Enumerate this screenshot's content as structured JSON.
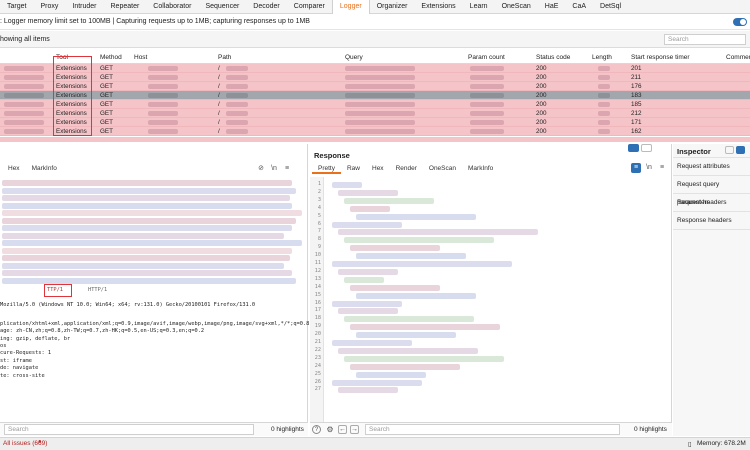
{
  "top_tabs": [
    "Target",
    "Proxy",
    "Intruder",
    "Repeater",
    "Collaborator",
    "Sequencer",
    "Decoder",
    "Comparer",
    "Logger",
    "Organizer",
    "Extensions",
    "Learn",
    "OneScan",
    "HaE",
    "CaA",
    "DetSql"
  ],
  "active_tab": "Logger",
  "message": ": Logger memory limit set to 100MB | Capturing requests up to 1MB; capturing responses up to 1MB",
  "filter": {
    "label": "howing all items",
    "search_placeholder": "Search"
  },
  "table": {
    "headers": [
      "Tool",
      "Method",
      "Host",
      "Path",
      "Query",
      "Param count",
      "Status code",
      "Length",
      "Start response timer",
      "Commen"
    ],
    "rows": [
      {
        "tool": "Extensions",
        "method": "GET",
        "path": "/",
        "status": "200",
        "timer": "201"
      },
      {
        "tool": "Extensions",
        "method": "GET",
        "path": "/",
        "status": "200",
        "timer": "211"
      },
      {
        "tool": "Extensions",
        "method": "GET",
        "path": "/",
        "status": "200",
        "timer": "176"
      },
      {
        "tool": "Extensions",
        "method": "GET",
        "path": "/",
        "status": "200",
        "timer": "183"
      },
      {
        "tool": "Extensions",
        "method": "GET",
        "path": "/",
        "status": "200",
        "timer": "185"
      },
      {
        "tool": "Extensions",
        "method": "GET",
        "path": "/",
        "status": "200",
        "timer": "212"
      },
      {
        "tool": "Extensions",
        "method": "GET",
        "path": "/",
        "status": "200",
        "timer": "171"
      },
      {
        "tool": "Extensions",
        "method": "GET",
        "path": "/",
        "status": "200",
        "timer": "162"
      }
    ],
    "selected_row": 3
  },
  "request": {
    "tabs": [
      "Hex",
      "MarkInfo"
    ],
    "header_lines": [
      "Mozilla/5.0 (Windows NT 10.0; Win64; x64; rv:131.0) Gecko/20100101 Firefox/131.0",
      "",
      "plication/xhtml+xml,application/xml;q=0.9,image/avif,image/webp,image/png,image/svg+xml,*/*;q=0.8",
      "age: zh-CN,zh;q=0.8,zh-TW;q=0.7,zh-HK;q=0.5,en-US;q=0.3,en;q=0.2",
      "ing: gzip, deflate, br",
      "os",
      "cure-Requests: 1",
      "st: iframe",
      "de: navigate",
      "te: cross-site"
    ],
    "marked_text": "TTP/1",
    "marked_text_2": "HTTP/1",
    "search_placeholder": "Search",
    "highlights": "0 highlights"
  },
  "response": {
    "title": "Response",
    "tabs": [
      "Pretty",
      "Raw",
      "Hex",
      "Render",
      "OneScan",
      "MarkInfo"
    ],
    "active_tab": "Pretty",
    "line_numbers": [
      "1",
      "2",
      "3",
      "4",
      "5",
      "6",
      "7",
      "8",
      "9",
      "10",
      "11",
      "12",
      "13",
      "14",
      "15",
      "16",
      "17",
      "18",
      "19",
      "20",
      "21",
      "22",
      "23",
      "24",
      "25",
      "26",
      "27"
    ],
    "search_placeholder": "Search",
    "highlights": "0 highlights"
  },
  "inspector": {
    "title": "Inspector",
    "items": [
      "Request attributes",
      "Request query parameters",
      "Request headers",
      "Response headers"
    ]
  },
  "status": {
    "issues": "All issues (669)",
    "memory": "Memory: 678.2M"
  },
  "colors": {
    "accent": "#e8711a",
    "row_highlight": "#f5c4c9",
    "selected_row": "#a2a6ad",
    "mark_red": "#e0343a",
    "blue": "#2f6fb4"
  }
}
